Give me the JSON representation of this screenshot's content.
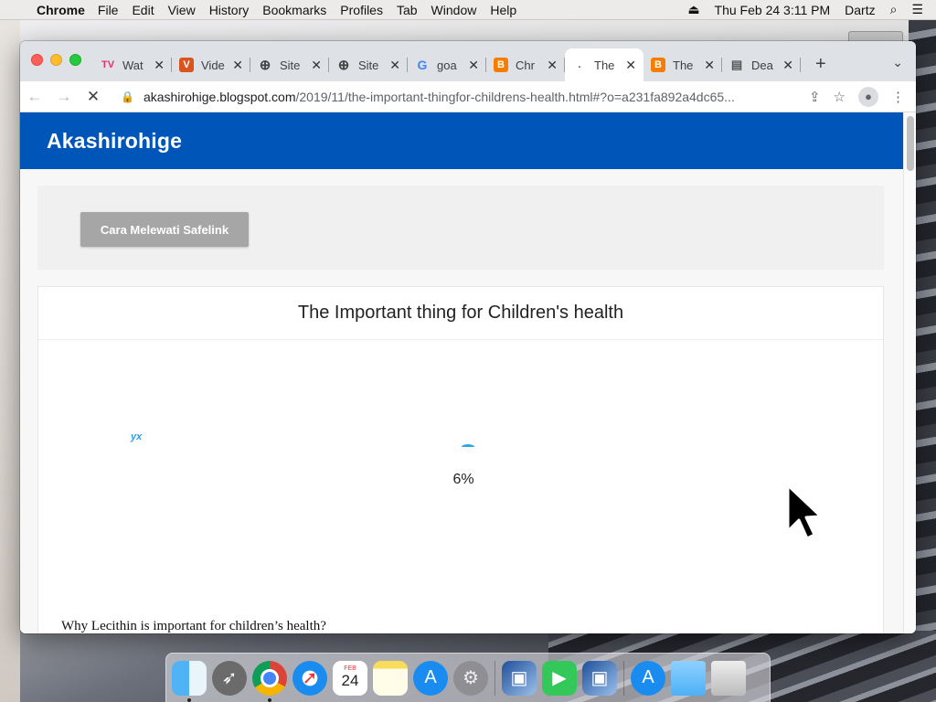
{
  "menubar": {
    "apple": "",
    "app_name": "Chrome",
    "items": [
      "File",
      "Edit",
      "View",
      "History",
      "Bookmarks",
      "Profiles",
      "Tab",
      "Window",
      "Help"
    ],
    "datetime": "Thu Feb 24  3:11 PM",
    "user": "Dartz"
  },
  "tabs": [
    {
      "title": "Wat",
      "icon": "tv-icon",
      "glyph": "TV",
      "active": false
    },
    {
      "title": "Vide",
      "icon": "v-icon",
      "glyph": "V",
      "active": false
    },
    {
      "title": "Site",
      "icon": "globe-icon",
      "glyph": "⊕",
      "active": false
    },
    {
      "title": "Site",
      "icon": "globe-icon",
      "glyph": "⊕",
      "active": false
    },
    {
      "title": "goa",
      "icon": "google-icon",
      "glyph": "G",
      "active": false
    },
    {
      "title": "Chr",
      "icon": "blogger-icon",
      "glyph": "B",
      "active": false
    },
    {
      "title": "The",
      "icon": "loading-dot-icon",
      "glyph": ".",
      "active": true
    },
    {
      "title": "The",
      "icon": "blogger-icon",
      "glyph": "B",
      "active": false
    },
    {
      "title": "Dea",
      "icon": "document-icon",
      "glyph": "▤",
      "active": false
    }
  ],
  "address_bar": {
    "domain": "akashirohige.blogspot.com",
    "path": "/2019/11/the-important-thingfor-childrens-health.html#?o=a231fa892a4dc65..."
  },
  "page": {
    "blog_title": "Akashirohige",
    "safelink_button": "Cara Melewati Safelink",
    "post_title": "The Important thing for Children's health",
    "logo_text_a": "y",
    "logo_text_b": "x",
    "progress": "6%",
    "question": "Why Lecithin is important for children’s health?"
  },
  "dock": {
    "calendar_month": "FEB",
    "calendar_day": "24"
  },
  "colors": {
    "blog_header": "#0056b8",
    "button_gray": "#a6a6a6",
    "spinner": "#29a8e0"
  }
}
